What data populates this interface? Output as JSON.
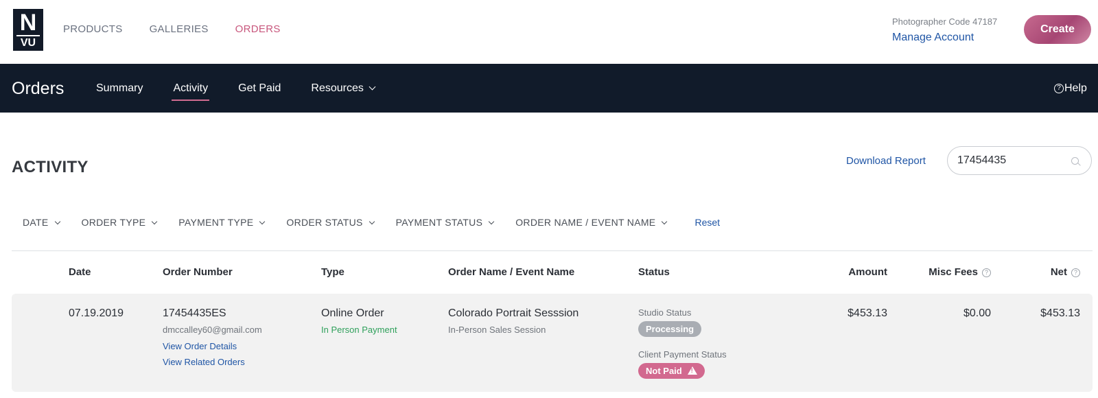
{
  "brand": {
    "logo_top": "N",
    "logo_bottom": "VU"
  },
  "top_nav": {
    "items": [
      "PRODUCTS",
      "GALLERIES",
      "ORDERS"
    ],
    "active": "ORDERS"
  },
  "account": {
    "code": "Photographer Code 47187",
    "manage_label": "Manage Account",
    "create_label": "Create"
  },
  "colors": {
    "accent": "#c8577d",
    "dark_nav": "#111b2a",
    "link": "#1f55a5",
    "green": "#2fa05b"
  },
  "section_nav": {
    "title": "Orders",
    "tabs": [
      "Summary",
      "Activity",
      "Get Paid",
      "Resources"
    ],
    "active": "Activity",
    "help_label": "Help"
  },
  "page": {
    "heading": "ACTIVITY",
    "download_label": "Download Report",
    "search": {
      "value": "17454435",
      "icon": "search-icon"
    }
  },
  "filters": {
    "items": [
      "DATE",
      "ORDER TYPE",
      "PAYMENT TYPE",
      "ORDER STATUS",
      "PAYMENT STATUS",
      "ORDER NAME / EVENT NAME"
    ],
    "reset_label": "Reset"
  },
  "table": {
    "columns": [
      "Date",
      "Order Number",
      "Type",
      "Order Name / Event Name",
      "Status",
      "Amount",
      "Misc Fees",
      "Net"
    ],
    "rows": [
      {
        "date": "07.19.2019",
        "order_number": "17454435ES",
        "email": "dmccalley60@gmail.com",
        "view_details": "View Order Details",
        "view_related": "View Related Orders",
        "type": "Online Order",
        "payment_type": "In Person Payment",
        "order_name": "Colorado Portrait Sesssion",
        "event_name": "In-Person Sales Session",
        "studio_status_label": "Studio Status",
        "studio_status": "Processing",
        "client_status_label": "Client Payment Status",
        "client_status": "Not Paid",
        "amount": "$453.13",
        "misc_fees": "$0.00",
        "net": "$453.13"
      }
    ]
  }
}
